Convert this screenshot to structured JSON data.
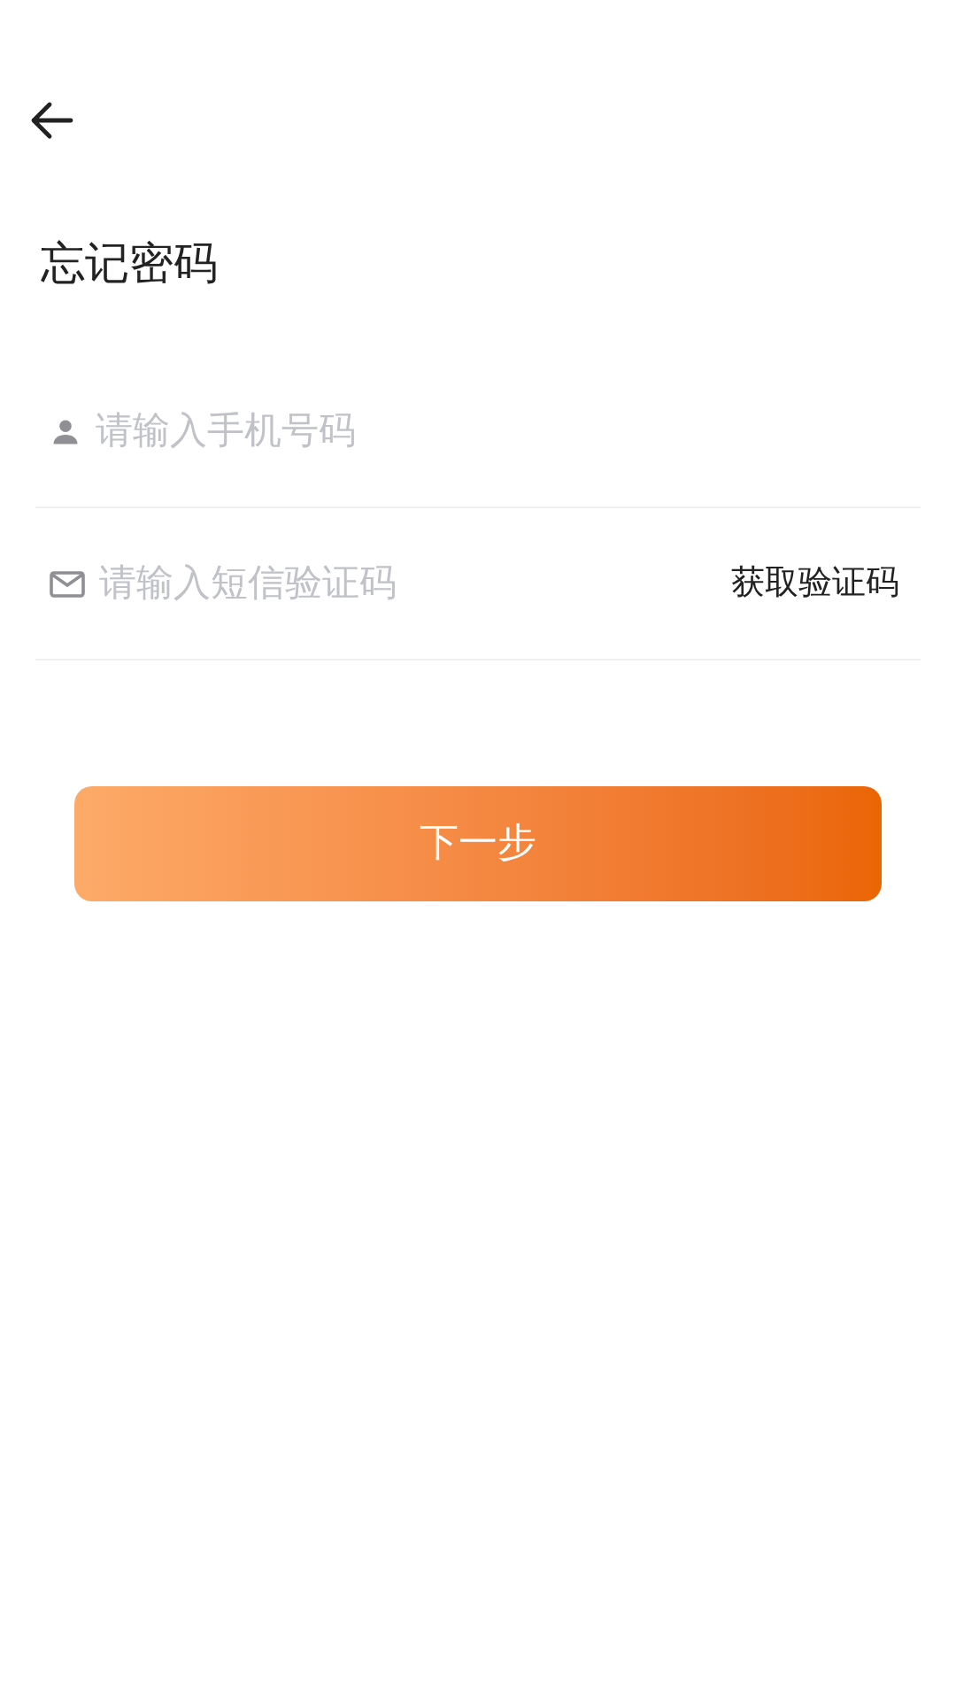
{
  "title": "忘记密码",
  "fields": [
    {
      "kind": "phone",
      "placeholder": "请输入手机号码"
    },
    {
      "kind": "code",
      "placeholder": "请输入短信验证码",
      "action": "获取验证码"
    }
  ],
  "submit": "下一步"
}
